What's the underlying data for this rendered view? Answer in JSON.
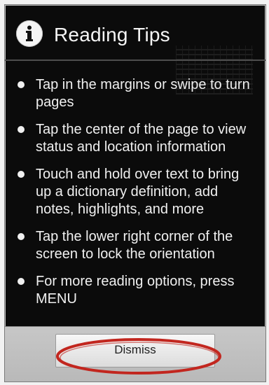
{
  "dialog": {
    "title": "Reading Tips",
    "icon": "info-icon",
    "tips": [
      {
        "text": "Tap in the margins or swipe to turn pages"
      },
      {
        "text": "Tap the center of the page to view status and location information"
      },
      {
        "text": "Touch and hold over text to bring up a dictionary definition, add notes, highlights, and more"
      },
      {
        "text": "Tap the lower right corner of the screen to lock the orientation"
      },
      {
        "text": "For more reading options, press MENU"
      }
    ],
    "dismiss_label": "Dismiss"
  },
  "colors": {
    "dialog_background": "#0b0b0b",
    "text": "#f0f0f0",
    "footer": "#c0c0c0",
    "highlight": "#c2271f"
  }
}
